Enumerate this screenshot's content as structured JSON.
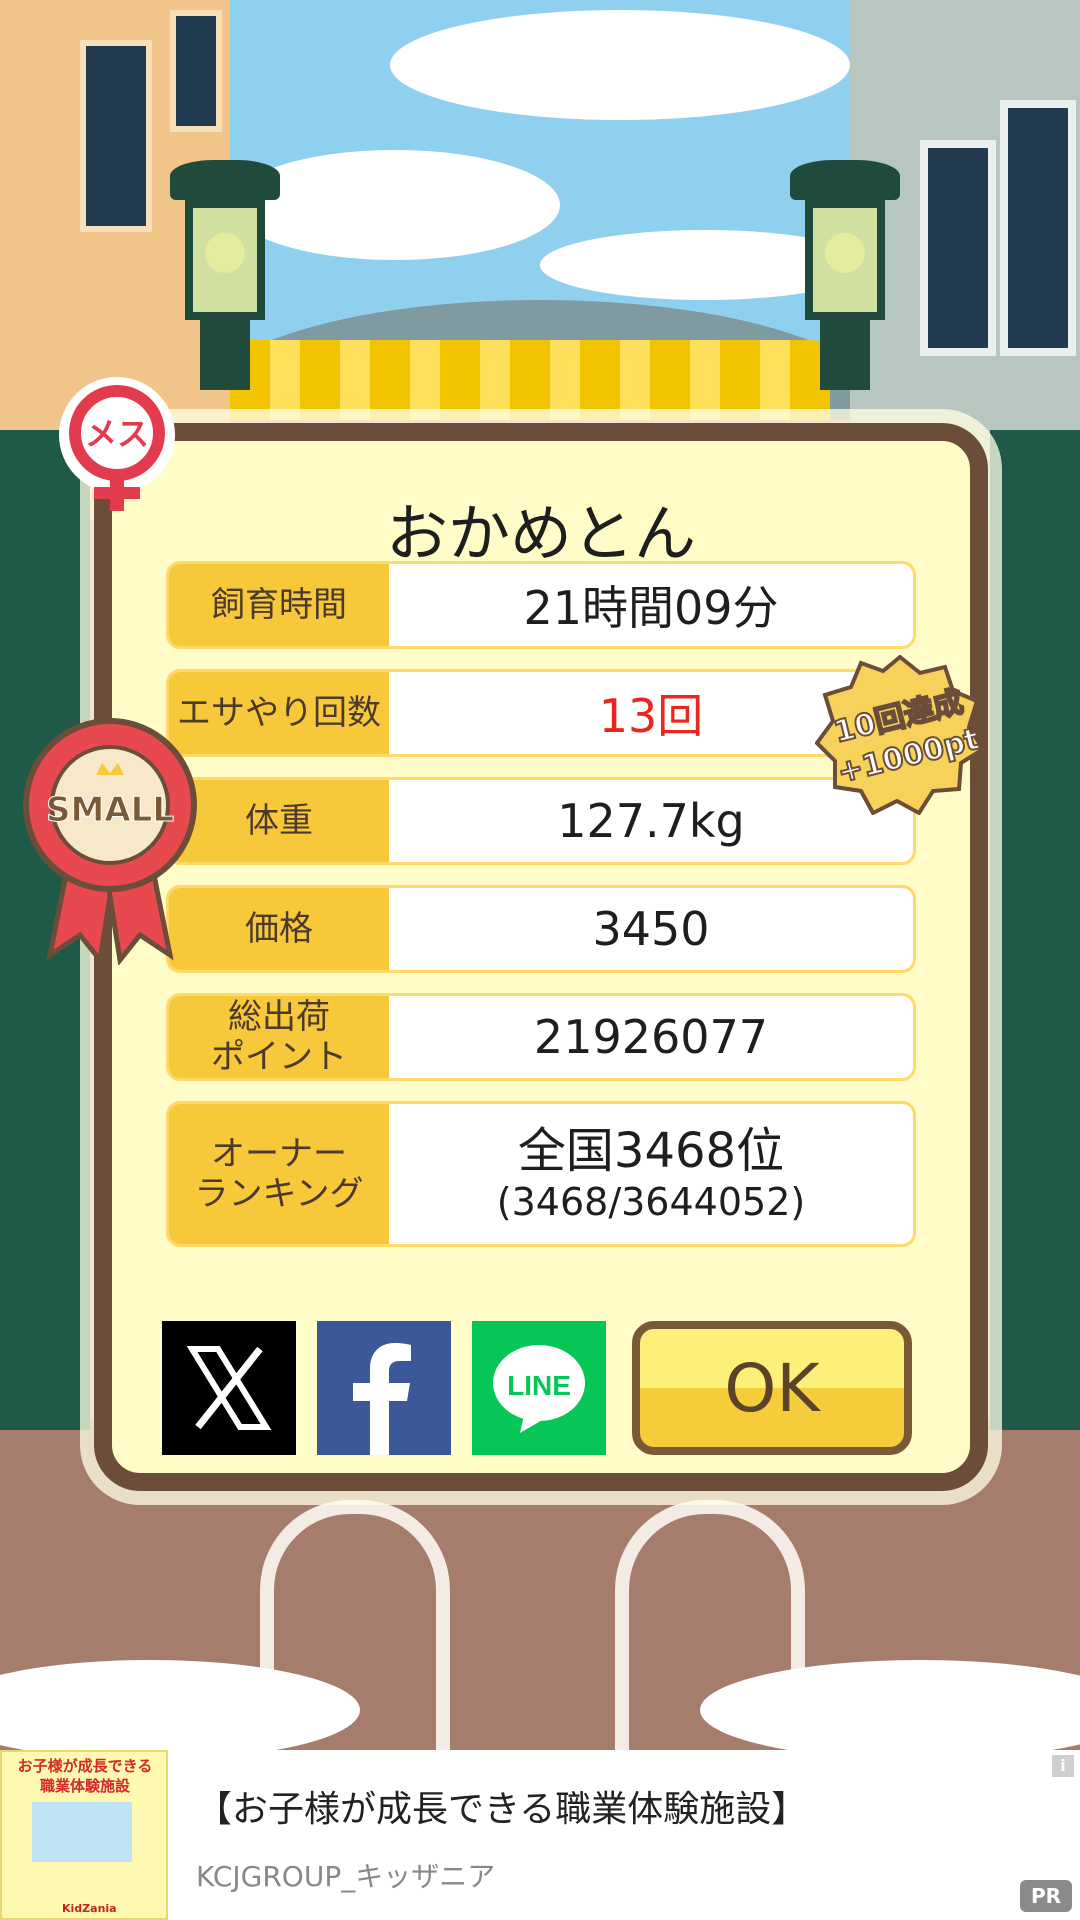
{
  "pig": {
    "name": "おかめとん",
    "gender_badge": "メス",
    "size_badge": "SMALL"
  },
  "stats": [
    {
      "label": "飼育時間",
      "value": "21時間09分"
    },
    {
      "label": "エサやり回数",
      "value": "13回"
    },
    {
      "label": "体重",
      "value": "127.7kg"
    },
    {
      "label": "価格",
      "value": "3450"
    },
    {
      "label": "総出荷\nポイント",
      "value": "21926077"
    }
  ],
  "ranking": {
    "label": "オーナー\nランキング",
    "main": "全国3468位",
    "sub": "(3468/3644052)"
  },
  "achievement": {
    "line1": "10回達成",
    "line2": "+1000pt"
  },
  "share": {
    "x": "X",
    "facebook": "f",
    "line": "LINE"
  },
  "ok_label": "OK",
  "ad": {
    "title": "【お子様が成長できる職業体験施設】",
    "sponsor": "KCJGROUP_キッザニア",
    "image_title": "お子様が成長できる\n職業体験施設",
    "image_brand": "KidZania",
    "info": "i",
    "pr": "PR"
  },
  "colors": {
    "frame": "#6b4d3a",
    "panel": "#fffcc7",
    "label_bg": "#f6c83a",
    "highlight_red": "#e9261f",
    "ok_top": "#fdf07a",
    "ok_bottom": "#f5cd3a"
  }
}
